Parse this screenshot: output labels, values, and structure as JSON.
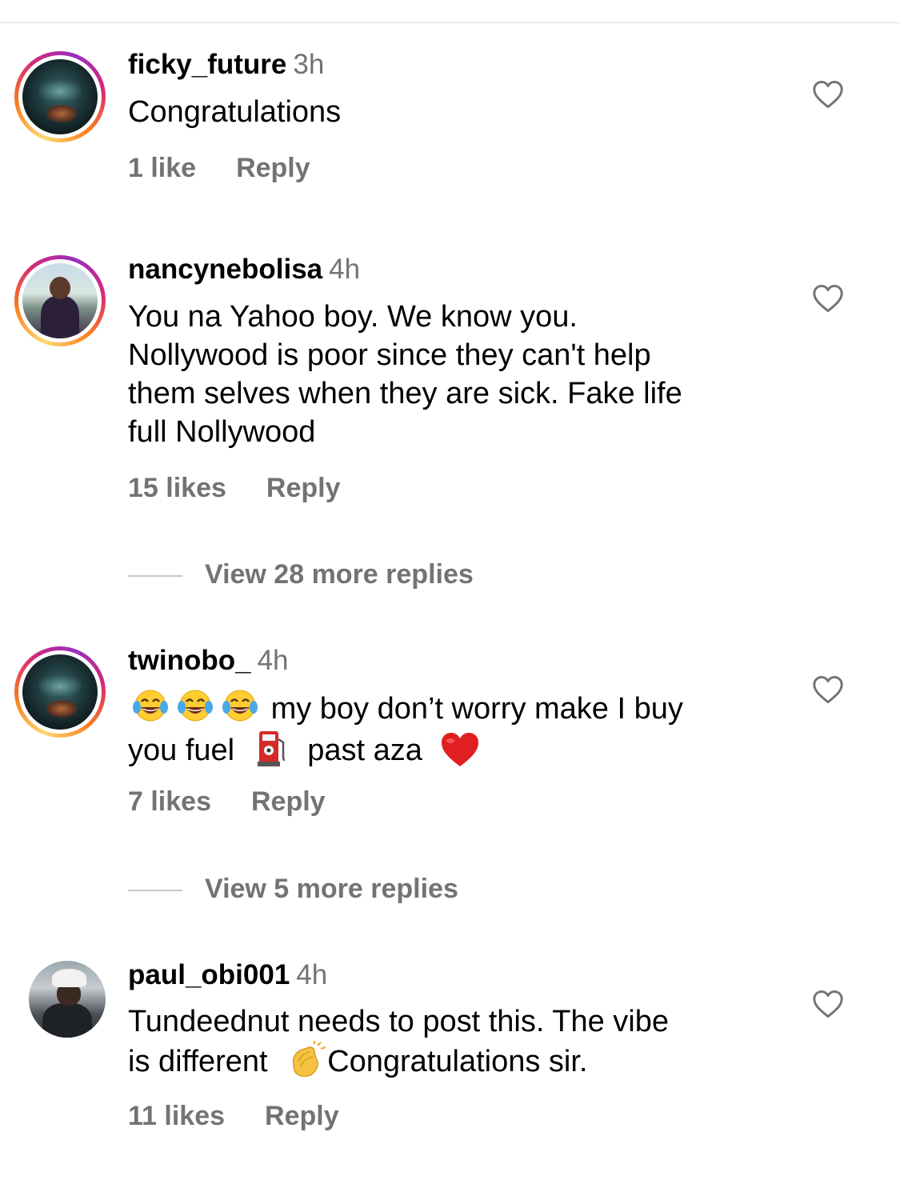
{
  "comments": [
    {
      "username": "ficky_future",
      "time": "3h",
      "text": "Congratulations",
      "likes": "1 like",
      "reply": "Reply"
    },
    {
      "username": "nancynebolisa",
      "time": "4h",
      "text_lines": [
        "You na Yahoo boy. We know you.",
        "Nollywood is poor since they can't help",
        "them selves when they are sick. Fake life",
        "full Nollywood"
      ],
      "likes": "15 likes",
      "reply": "Reply",
      "view_replies": "View 28 more replies"
    },
    {
      "username": "twinobo_",
      "time": "4h",
      "text_part1": "my boy don’t worry make I buy",
      "text_part2": "you fuel",
      "text_part3": "past aza",
      "emojis": [
        "laughing-face",
        "laughing-face",
        "laughing-face",
        "fuel-pump",
        "red-heart"
      ],
      "likes": "7 likes",
      "reply": "Reply",
      "view_replies": "View 5 more replies"
    },
    {
      "username": "paul_obi001",
      "time": "4h",
      "text_line1": "Tundeednut needs to post this. The vibe",
      "text_part2": "is different",
      "text_part3": "Congratulations sir.",
      "emojis": [
        "clapping-hands"
      ],
      "likes": "11 likes",
      "reply": "Reply"
    }
  ],
  "colors": {
    "secondary_text": "#737373",
    "divider": "#dbdbdb",
    "heart_stroke": "#737373"
  }
}
